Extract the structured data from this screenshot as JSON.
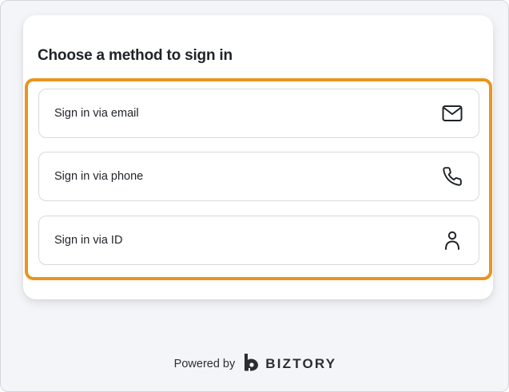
{
  "signin": {
    "title": "Choose a method to sign in",
    "options": [
      {
        "label": "Sign in via email",
        "icon": "mail-icon"
      },
      {
        "label": "Sign in via phone",
        "icon": "phone-icon"
      },
      {
        "label": "Sign in via ID",
        "icon": "user-icon"
      }
    ]
  },
  "footer": {
    "powered_by": "Powered by",
    "brand": "BIZTORY",
    "brand_icon": "biztory-logo-icon"
  },
  "colors": {
    "highlight": "#e8951e",
    "background": "#f4f5f9",
    "card": "#ffffff",
    "text": "#1f2328"
  }
}
